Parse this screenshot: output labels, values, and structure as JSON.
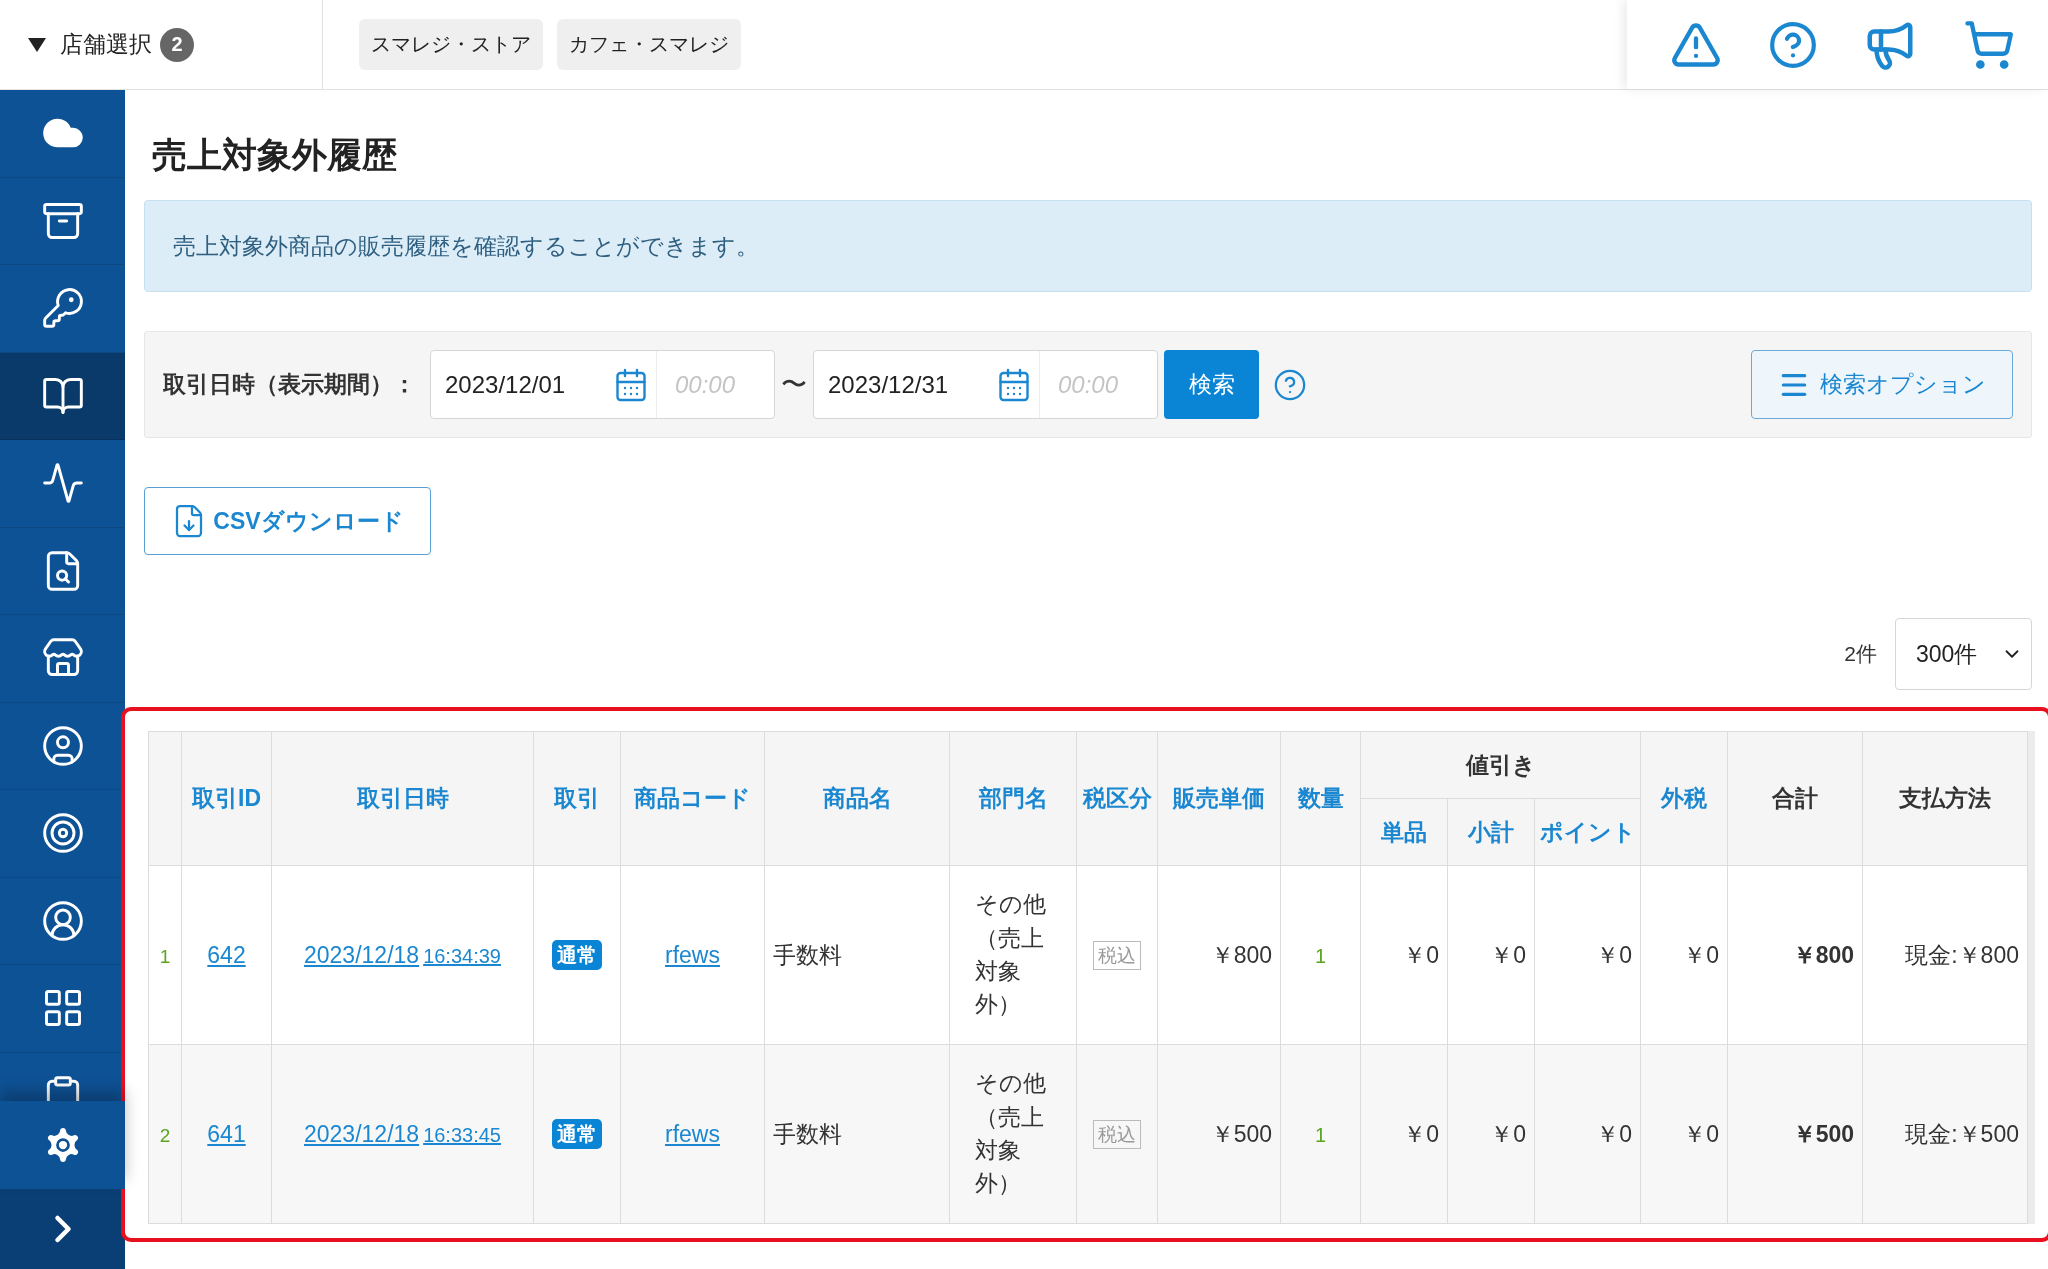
{
  "store_selector": {
    "label": "店舗選択",
    "count": "2"
  },
  "store_tags": [
    "スマレジ・ストア",
    "カフェ・スマレジ"
  ],
  "sidebar": {
    "items": [
      {
        "selected": false
      },
      {
        "selected": false
      },
      {
        "selected": false
      },
      {
        "selected": true
      },
      {
        "selected": false
      },
      {
        "selected": false
      },
      {
        "selected": false
      },
      {
        "selected": false
      },
      {
        "selected": false
      },
      {
        "selected": false
      },
      {
        "selected": false
      },
      {
        "selected": false
      }
    ]
  },
  "page_title": "売上対象外履歴",
  "info_message": "売上対象外商品の販売履歴を確認することができます。",
  "filter": {
    "label": "取引日時（表示期間）：",
    "from_date": "2023/12/01",
    "from_time_placeholder": "00:00",
    "separator": "〜",
    "to_date": "2023/12/31",
    "to_time_placeholder": "00:00",
    "search_button": "検索",
    "options_button": "検索オプション"
  },
  "csv_button": "CSVダウンロード",
  "result_count": "2件",
  "page_size": "300件",
  "table": {
    "columns": [
      {
        "label": "取引ID",
        "sortable": true
      },
      {
        "label": "取引日時",
        "sortable": true
      },
      {
        "label": "取引",
        "sortable": true
      },
      {
        "label": "商品コード",
        "sortable": true
      },
      {
        "label": "商品名",
        "sortable": true
      },
      {
        "label": "部門名",
        "sortable": true
      },
      {
        "label": "税区分",
        "sortable": true
      },
      {
        "label": "販売単価",
        "sortable": true
      },
      {
        "label": "数量",
        "sortable": true
      },
      {
        "label": "値引き",
        "sortable": false,
        "children": [
          {
            "label": "単品",
            "sortable": true
          },
          {
            "label": "小計",
            "sortable": true
          },
          {
            "label": "ポイント",
            "sortable": true
          }
        ]
      },
      {
        "label": "外税",
        "sortable": true
      },
      {
        "label": "合計",
        "sortable": false
      },
      {
        "label": "支払方法",
        "sortable": false
      }
    ],
    "rows": [
      {
        "index": "1",
        "id": "642",
        "date": "2023/12/18",
        "time": "16:34:39",
        "type": "通常",
        "product_code": "rfews",
        "product_name": "手数料",
        "department": "その他（売上対象外）",
        "tax_category": "税込",
        "unit_price": "￥800",
        "quantity": "1",
        "discount_unit": "￥0",
        "discount_subtotal": "￥0",
        "discount_points": "￥0",
        "external_tax": "￥0",
        "total": "￥800",
        "payment": "現金:￥800"
      },
      {
        "index": "2",
        "id": "641",
        "date": "2023/12/18",
        "time": "16:33:45",
        "type": "通常",
        "product_code": "rfews",
        "product_name": "手数料",
        "department": "その他（売上対象外）",
        "tax_category": "税込",
        "unit_price": "￥500",
        "quantity": "1",
        "discount_unit": "￥0",
        "discount_subtotal": "￥0",
        "discount_points": "￥0",
        "external_tax": "￥0",
        "total": "￥500",
        "payment": "現金:￥500"
      }
    ]
  }
}
